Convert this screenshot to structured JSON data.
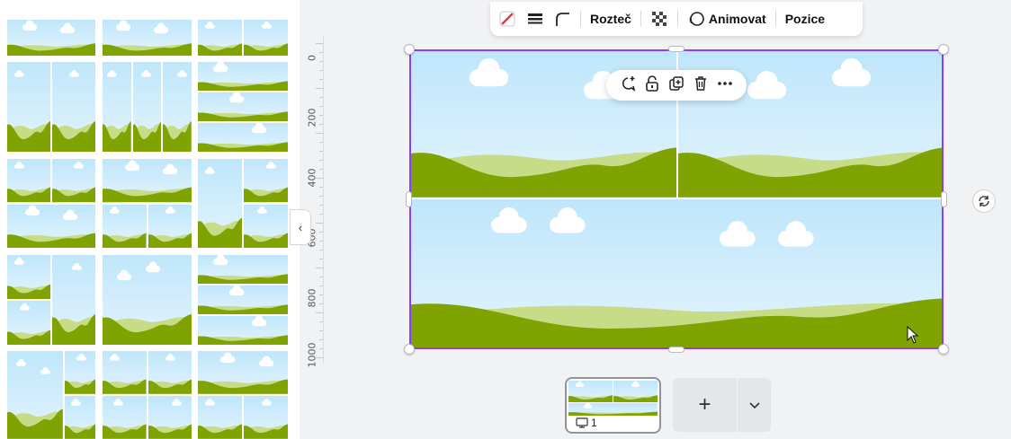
{
  "toolbar": {
    "spacing_label": "Rozteč",
    "animate_label": "Animovat",
    "position_label": "Pozice",
    "icons": [
      "no-color-icon",
      "stroke-weight-icon",
      "corner-rounding-icon",
      "transparency-icon",
      "animate-icon"
    ]
  },
  "ruler": {
    "labels": [
      "0",
      "200",
      "400",
      "600",
      "800",
      "1000"
    ]
  },
  "context_menu": {
    "icons": [
      "comment-add-icon",
      "lock-icon",
      "duplicate-icon",
      "delete-icon",
      "more-icon"
    ]
  },
  "bottom": {
    "page_number": "1",
    "add_symbol": "+"
  },
  "colors": {
    "selection": "#8b3dff",
    "hill_dark": "#7fa300",
    "hill_light": "#c6dc86",
    "sky_top": "#bfe6fb",
    "sky_bottom": "#e4f4fd"
  }
}
